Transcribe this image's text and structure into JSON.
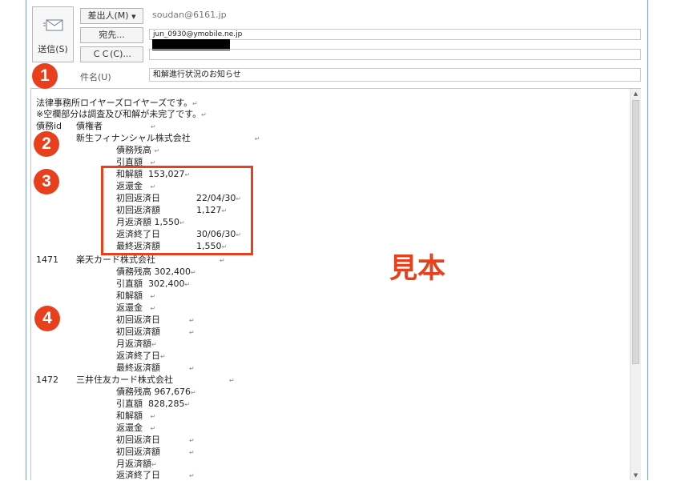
{
  "header": {
    "send_label": "送信(S)",
    "from_button": "差出人(M)",
    "from_value": "soudan@6161.jp",
    "to_button": "宛先...",
    "to_value": "jun_0930@ymobile.ne.jp",
    "cc_button": "ＣＣ(C)...",
    "cc_value": "",
    "subject_label": "件名(U)",
    "subject_value": "和解進行状況のお知らせ"
  },
  "body": {
    "intro": [
      "法律事務所ロイヤーズロイヤーズです。",
      "※空欄部分は調査及び和解が未完了です。"
    ],
    "table_header": {
      "id": "債務id",
      "creditor": "債権者"
    },
    "creditors": [
      {
        "id": "",
        "name": "新生フィナンシャル株式会社",
        "rows": [
          {
            "label": "債務残高",
            "value": ""
          },
          {
            "label": "引直額",
            "value": ""
          },
          {
            "label": "和解額",
            "value": "153,027"
          },
          {
            "label": "返還金",
            "value": ""
          },
          {
            "label": "初回返済日",
            "value": "22/04/30"
          },
          {
            "label": "初回返済額",
            "value": "1,127"
          },
          {
            "label": "月返済額",
            "value": "1,550"
          },
          {
            "label": "返済終了日",
            "value": "30/06/30"
          },
          {
            "label": "最終返済額",
            "value": "1,550"
          }
        ]
      },
      {
        "id": "1471",
        "name": "楽天カード株式会社",
        "rows": [
          {
            "label": "債務残高",
            "value": "302,400"
          },
          {
            "label": "引直額",
            "value": "302,400"
          },
          {
            "label": "和解額",
            "value": ""
          },
          {
            "label": "返還金",
            "value": ""
          },
          {
            "label": "初回返済日",
            "value": ""
          },
          {
            "label": "初回返済額",
            "value": ""
          },
          {
            "label": "月返済額",
            "value": ""
          },
          {
            "label": "返済終了日",
            "value": ""
          },
          {
            "label": "最終返済額",
            "value": ""
          }
        ]
      },
      {
        "id": "1472",
        "name": "三井住友カード株式会社",
        "rows": [
          {
            "label": "債務残高",
            "value": "967,676"
          },
          {
            "label": "引直額",
            "value": "828,285"
          },
          {
            "label": "和解額",
            "value": ""
          },
          {
            "label": "返還金",
            "value": ""
          },
          {
            "label": "初回返済日",
            "value": ""
          },
          {
            "label": "初回返済額",
            "value": ""
          },
          {
            "label": "月返済額",
            "value": ""
          },
          {
            "label": "返済終了日",
            "value": ""
          }
        ]
      }
    ]
  },
  "annotations": {
    "badges": [
      "1",
      "2",
      "3",
      "4"
    ],
    "sample_label": "見本",
    "accent_color": "#e8401c"
  },
  "icons": {
    "send": "envelope-icon",
    "dropdown": "chevron-down-icon",
    "scroll_up": "arrow-up-icon",
    "scroll_down": "arrow-down-icon"
  }
}
